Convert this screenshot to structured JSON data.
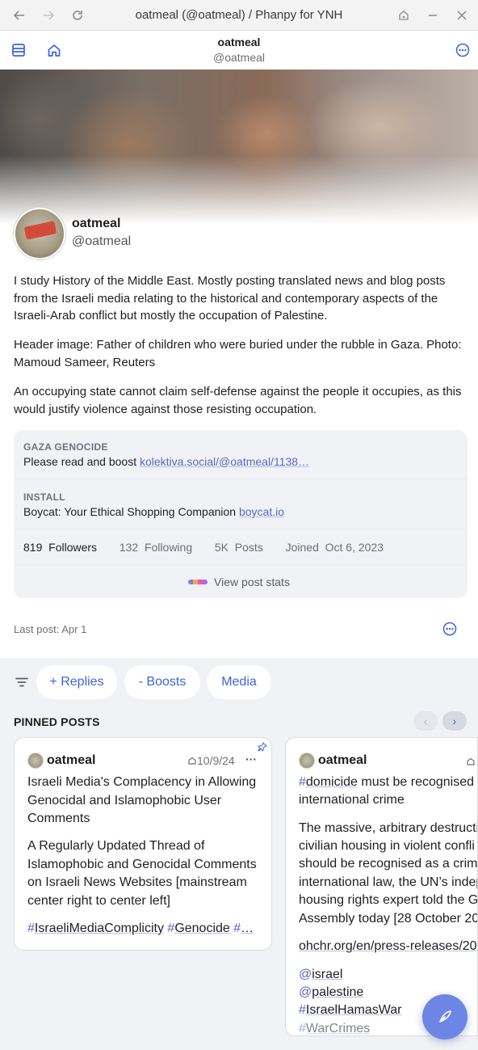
{
  "window": {
    "title": "oatmeal (@oatmeal) / Phanpy for YNH",
    "back_icon": "arrow-left-icon",
    "forward_icon": "arrow-right-icon",
    "reload_icon": "reload-icon"
  },
  "header": {
    "name": "oatmeal",
    "handle": "@oatmeal"
  },
  "profile": {
    "display_name": "oatmeal",
    "handle": "@oatmeal",
    "bio": [
      "I study History of the Middle East. Mostly posting translated news and blog posts from the Israeli media relating to the historical and contemporary aspects of the Israeli-Arab conflict but mostly the occupation of Palestine.",
      "Header image: Father of children who were buried under the rubble in Gaza. Photo: Mamoud Sameer, Reuters",
      "An occupying state cannot claim self-defense against the people it occupies, as this would justify violence against those resisting occupation."
    ],
    "fields": [
      {
        "key": "GAZA GENOCIDE",
        "text": "Please read and boost ",
        "link": "kolektiva.social/@oatmeal/1138…"
      },
      {
        "key": "INSTALL",
        "text": "Boycat: Your Ethical Shopping Companion ",
        "link": "boycat.io"
      }
    ],
    "stats": {
      "followers_count": "819",
      "followers_label": "Followers",
      "following_count": "132",
      "following_label": "Following",
      "posts_count": "5K",
      "posts_label": "Posts",
      "joined_label": "Joined",
      "joined_date": "Oct 6, 2023"
    },
    "view_stats": "View post stats",
    "last_post": "Last post: Apr 1"
  },
  "filters": {
    "replies": "+ Replies",
    "boosts": "- Boosts",
    "media": "Media"
  },
  "pinned": {
    "label": "PINNED POSTS",
    "posts": [
      {
        "author": "oatmeal",
        "date": "10/9/24",
        "title": "Israeli Media's Complacency in Allowing Genocidal and Islamophobic User Comments",
        "body": "A Regularly Updated Thread of Islamophobic and Genocidal Comments on Israeli News Websites [mainstream center right to center left]",
        "tags": [
          "IsraeliMediaComplicity",
          "Genocide",
          "…"
        ]
      },
      {
        "author": "oatmeal",
        "tag_line_tag": "domicide",
        "tag_line_rest": " must be recognised",
        "line2": "international crime",
        "body_lines": [
          "The massive, arbitrary destructi",
          "civilian housing in violent confli",
          "should be recognised as a crim",
          "international law, the UN’s indep",
          "housing rights expert told the G",
          "Assembly today [28 October 20"
        ],
        "link": "ohchr.org/en/press-releases/20",
        "mentions": [
          "israel",
          "palestine"
        ],
        "tags": [
          "IsraelHamasWar",
          "WarCrimes"
        ]
      }
    ]
  }
}
